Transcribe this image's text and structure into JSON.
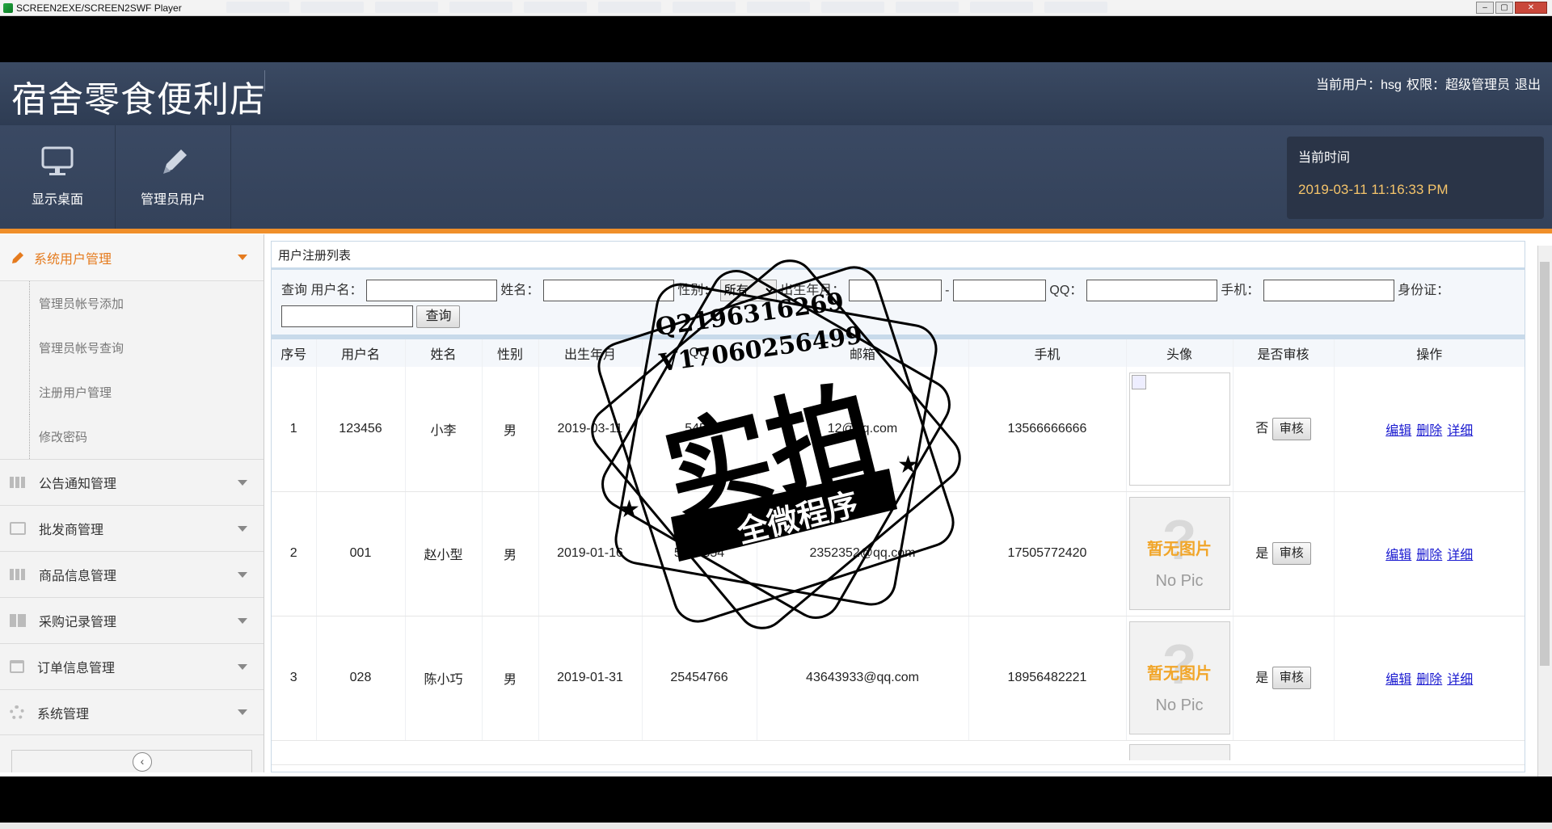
{
  "player": {
    "title": "SCREEN2EXE/SCREEN2SWF Player"
  },
  "app": {
    "title": "宿舍零食便利店",
    "user_label": "当前用户：hsg",
    "role_label": "权限：超级管理员",
    "logout": "退出"
  },
  "nav": {
    "items": [
      {
        "label": "显示桌面",
        "icon": "monitor-icon"
      },
      {
        "label": "管理员用户",
        "icon": "pencil-icon"
      }
    ],
    "time_label": "当前时间",
    "time_value": "2019-03-11 11:16:33 PM"
  },
  "sidebar": {
    "active_group": "系统用户管理",
    "sub_items": [
      "管理员帐号添加",
      "管理员帐号查询",
      "注册用户管理",
      "修改密码"
    ],
    "groups": [
      "公告通知管理",
      "批发商管理",
      "商品信息管理",
      "采购记录管理",
      "订单信息管理",
      "系统管理"
    ]
  },
  "main": {
    "panel_title": "用户注册列表",
    "search": {
      "prefix": "查询",
      "username_label": "用户名：",
      "name_label": "姓名：",
      "gender_label": "性别：",
      "gender_value": "所有",
      "birth_label": "出生年月：",
      "range_sep": "-",
      "qq_label": "QQ：",
      "phone_label": "手机：",
      "id_label": "身份证：",
      "button": "查询"
    },
    "columns": [
      "序号",
      "用户名",
      "姓名",
      "性别",
      "出生年月",
      "QQ",
      "邮箱",
      "手机",
      "头像",
      "是否审核",
      "操作"
    ],
    "rows": [
      {
        "no": "1",
        "username": "123456",
        "name": "小李",
        "gender": "男",
        "birth": "2019-03-11",
        "qq": "5454",
        "email": "12@qq.com",
        "phone": "13566666666",
        "avatar": "broken",
        "approved": "否"
      },
      {
        "no": "2",
        "username": "001",
        "name": "赵小型",
        "gender": "男",
        "birth": "2019-01-16",
        "qq": "5437354",
        "email": "2352352@qq.com",
        "phone": "17505772420",
        "avatar": "nopic",
        "approved": "是"
      },
      {
        "no": "3",
        "username": "028",
        "name": "陈小巧",
        "gender": "男",
        "birth": "2019-01-31",
        "qq": "25454766",
        "email": "43643933@qq.com",
        "phone": "18956482221",
        "avatar": "nopic",
        "approved": "是"
      }
    ],
    "approve_button": "审核",
    "ops": {
      "edit": "编辑",
      "delete": "删除",
      "detail": "详细"
    },
    "nopic": {
      "zh": "暂无图片",
      "en": "No Pic"
    }
  },
  "watermark": {
    "line1": "Q2196316269",
    "line2": "V17060256499",
    "main": "实拍",
    "banner": "全微程序"
  }
}
